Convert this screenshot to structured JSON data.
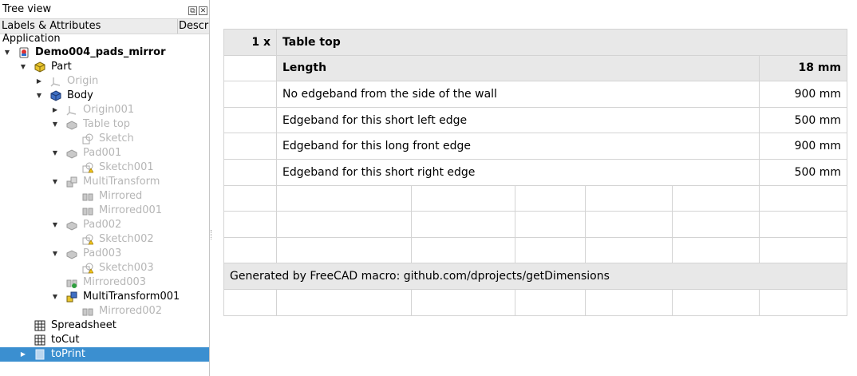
{
  "tree_panel": {
    "title": "Tree view",
    "header_labels": "Labels & Attributes",
    "header_desc": "Descri",
    "items": [
      {
        "label": "Application"
      },
      {
        "label": "Demo004_pads_mirror"
      },
      {
        "label": "Part"
      },
      {
        "label": "Origin"
      },
      {
        "label": "Body"
      },
      {
        "label": "Origin001"
      },
      {
        "label": "Table top"
      },
      {
        "label": "Sketch"
      },
      {
        "label": "Pad001"
      },
      {
        "label": "Sketch001"
      },
      {
        "label": "MultiTransform"
      },
      {
        "label": "Mirrored"
      },
      {
        "label": "Mirrored001"
      },
      {
        "label": "Pad002"
      },
      {
        "label": "Sketch002"
      },
      {
        "label": "Pad003"
      },
      {
        "label": "Sketch003"
      },
      {
        "label": "Mirrored003"
      },
      {
        "label": "MultiTransform001"
      },
      {
        "label": "Mirrored002"
      },
      {
        "label": "Spreadsheet"
      },
      {
        "label": "toCut"
      },
      {
        "label": "toPrint"
      }
    ]
  },
  "sheet": {
    "qty": "1 x",
    "part_name": "Table top",
    "length_label": "Length",
    "length_value": "18 mm",
    "edges": [
      {
        "label": "No edgeband from the side of the wall",
        "value": "900 mm"
      },
      {
        "label": "Edgeband for this short left edge",
        "value": "500 mm"
      },
      {
        "label": "Edgeband for this long front edge",
        "value": "900 mm"
      },
      {
        "label": "Edgeband for this short right edge",
        "value": "500 mm"
      }
    ],
    "footer": "Generated by FreeCAD macro: github.com/dprojects/getDimensions"
  },
  "colors": {
    "selection": "#3b8fd0",
    "header_gray": "#e8e8e8",
    "faded_text": "#b6b6b6"
  }
}
